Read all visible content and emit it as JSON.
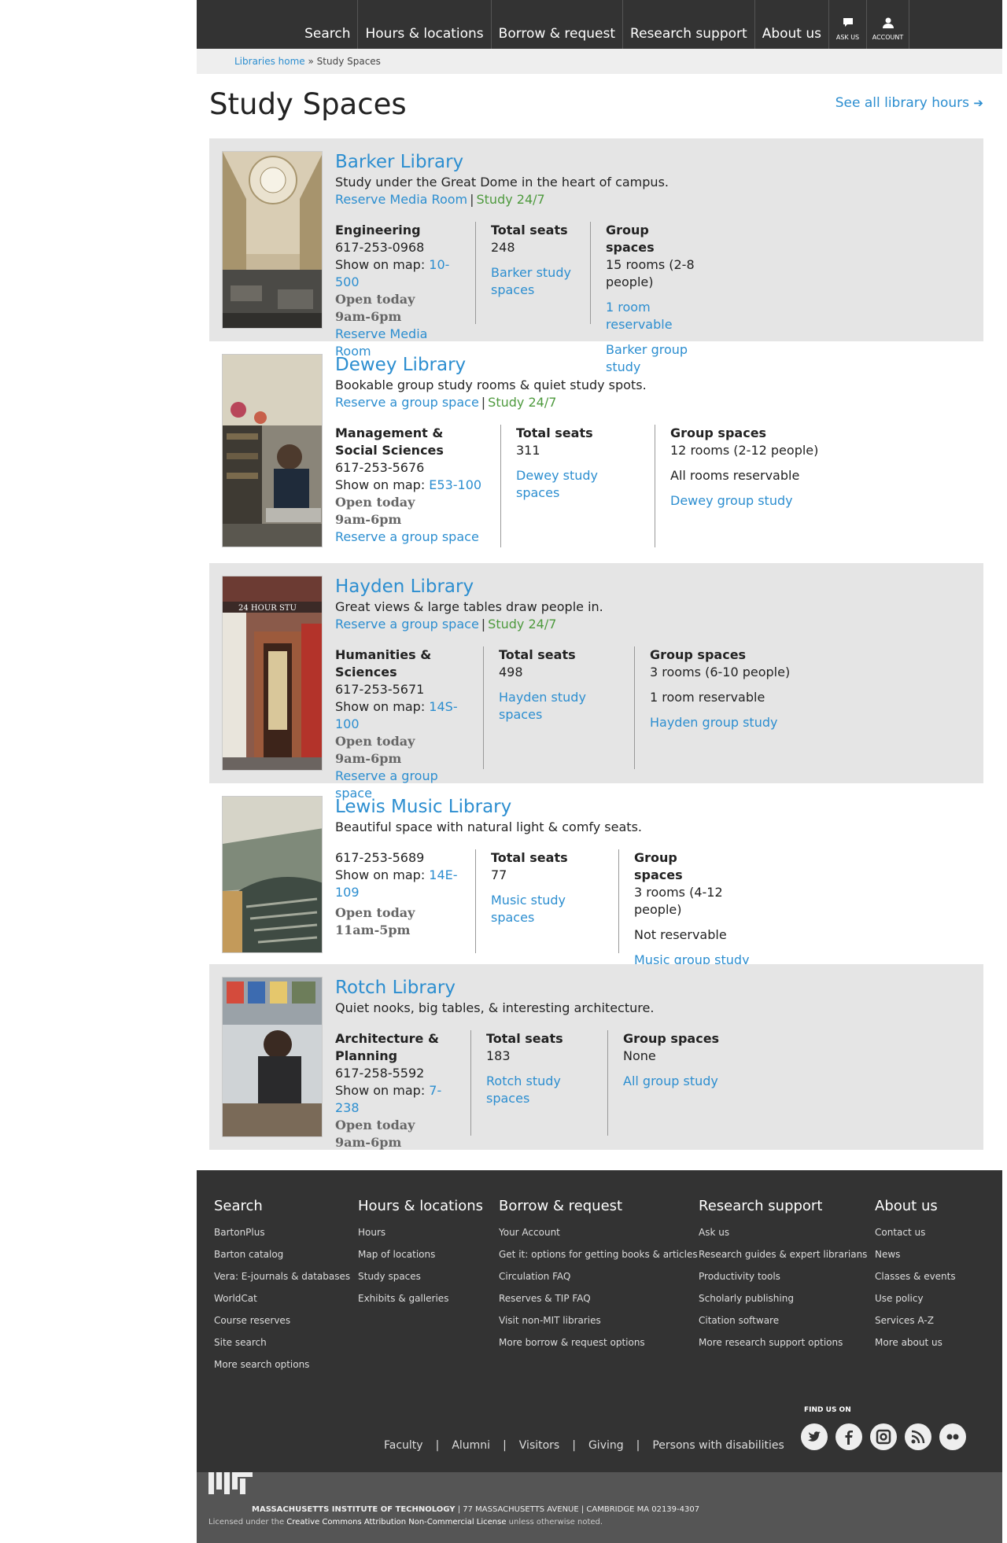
{
  "nav": {
    "items": [
      "Search",
      "Hours & locations",
      "Borrow & request",
      "Research support",
      "About us"
    ],
    "ask_us": "ASK US",
    "account": "ACCOUNT"
  },
  "breadcrumb": {
    "home": "Libraries home",
    "sep": " » ",
    "current": "Study Spaces"
  },
  "page_title": "Study Spaces",
  "all_hours": "See all library hours",
  "libraries": [
    {
      "name": "Barker Library",
      "desc": "Study under the Great Dome in the heart of campus.",
      "link1": "Reserve Media Room",
      "study247": "Study 24/7",
      "dept": "Engineering",
      "phone": "617-253-0968",
      "map_label": "Show on map: ",
      "map": "10-500",
      "open_label": "Open today",
      "hours": "9am-6pm",
      "reserve": "Reserve Media Room",
      "seats_label": "Total seats",
      "seats": "248",
      "study_link": "Barker study spaces",
      "group_label": "Group spaces",
      "group_rooms": "15 rooms (2-8 people)",
      "group_reserve": "1 room reservable",
      "group_link": "Barker group study"
    },
    {
      "name": "Dewey Library",
      "desc": "Bookable group study rooms & quiet study spots.",
      "link1": "Reserve a group space",
      "study247": "Study 24/7",
      "dept": "Management & Social Sciences",
      "phone": "617-253-5676",
      "map_label": "Show on map: ",
      "map": "E53-100",
      "open_label": "Open today",
      "hours": "9am-6pm",
      "reserve": "Reserve a group space",
      "seats_label": "Total seats",
      "seats": "311",
      "study_link": "Dewey study spaces",
      "group_label": "Group spaces",
      "group_rooms": "12 rooms (2-12 people)",
      "group_reserve": "All rooms reservable",
      "group_link": "Dewey group study"
    },
    {
      "name": "Hayden Library",
      "desc": "Great views & large tables draw people in.",
      "link1": "Reserve a group space",
      "study247": "Study 24/7",
      "dept": "Humanities & Sciences",
      "phone": "617-253-5671",
      "map_label": "Show on map: ",
      "map": "14S-100",
      "open_label": "Open today",
      "hours": "9am-6pm",
      "reserve": "Reserve a group space",
      "seats_label": "Total seats",
      "seats": "498",
      "study_link": "Hayden study spaces",
      "group_label": "Group spaces",
      "group_rooms": "3 rooms (6-10 people)",
      "group_reserve": "1 room reservable",
      "group_link": "Hayden group study"
    },
    {
      "name": "Lewis Music Library",
      "desc": "Beautiful space with natural light & comfy seats.",
      "phone": "617-253-5689",
      "map_label": "Show on map: ",
      "map": "14E-109",
      "open_label": "Open today",
      "hours": "11am-5pm",
      "seats_label": "Total seats",
      "seats": "77",
      "study_link": "Music study spaces",
      "group_label": "Group spaces",
      "group_rooms": "3 rooms (4-12 people)",
      "group_reserve": "Not reservable",
      "group_link": "Music group study"
    },
    {
      "name": "Rotch Library",
      "desc": "Quiet nooks, big tables, & interesting architecture.",
      "dept": "Architecture & Planning",
      "phone": "617-258-5592",
      "map_label": "Show on map: ",
      "map": "7-238",
      "open_label": "Open today",
      "hours": "9am-6pm",
      "seats_label": "Total seats",
      "seats": "183",
      "study_link": "Rotch study spaces",
      "group_label": "Group spaces",
      "group_rooms": "None",
      "group_link": "All group study"
    }
  ],
  "footer": {
    "cols": [
      {
        "title": "Search",
        "links": [
          "BartonPlus",
          "Barton catalog",
          "Vera: E-journals & databases",
          "WorldCat",
          "Course reserves",
          "Site search",
          "More search options"
        ]
      },
      {
        "title": "Hours & locations",
        "links": [
          "Hours",
          "Map of locations",
          "Study spaces",
          "Exhibits & galleries"
        ]
      },
      {
        "title": "Borrow & request",
        "links": [
          "Your Account",
          "Get it: options for getting books & articles",
          "Circulation FAQ",
          "Reserves & TIP FAQ",
          "Visit non-MIT libraries",
          "More borrow & request options"
        ]
      },
      {
        "title": "Research support",
        "links": [
          "Ask us",
          "Research guides & expert librarians",
          "Productivity tools",
          "Scholarly publishing",
          "Citation software",
          "More research support options"
        ]
      },
      {
        "title": "About us",
        "links": [
          "Contact us",
          "News",
          "Classes & events",
          "Use policy",
          "Services A-Z",
          "More about us"
        ]
      }
    ],
    "bottom_links": [
      "Faculty",
      "Alumni",
      "Visitors",
      "Giving",
      "Persons with disabilities"
    ],
    "find_us": "FIND US ON",
    "social_icons": [
      "twitter-icon",
      "facebook-icon",
      "instagram-icon",
      "rss-icon",
      "flickr-icon"
    ],
    "mit_name": "MASSACHUSETTS INSTITUTE OF TECHNOLOGY",
    "mit_address": " | 77 MASSACHUSETTS AVENUE | CAMBRIDGE MA 02139-4307",
    "license_pre": "Licensed under the ",
    "license_link": "Creative Commons Attribution Non-Commercial License",
    "license_post": " unless otherwise noted."
  }
}
